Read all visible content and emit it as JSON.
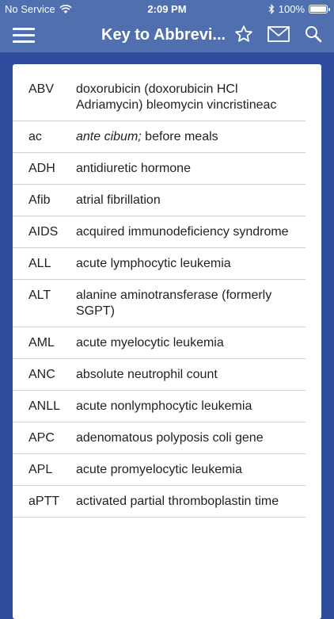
{
  "status": {
    "carrier": "No Service",
    "time": "2:09 PM",
    "battery": "100%",
    "battery_level": 1.0
  },
  "nav": {
    "title": "Key to Abbrevi..."
  },
  "rows": [
    {
      "abbr": "ABV",
      "def": "doxorubicin (doxorubicin HCl Adriamycin) bleomycin vincristineac"
    },
    {
      "abbr": "ac",
      "def_italic": "ante cibum;",
      "def": " before meals"
    },
    {
      "abbr": "ADH",
      "def": "antidiuretic hormone"
    },
    {
      "abbr": "Afib",
      "def": "atrial fibrillation"
    },
    {
      "abbr": "AIDS",
      "def": "acquired immunodeficiency syndrome"
    },
    {
      "abbr": "ALL",
      "def": "acute lymphocytic leukemia"
    },
    {
      "abbr": "ALT",
      "def": "alanine aminotransferase (formerly SGPT)"
    },
    {
      "abbr": "AML",
      "def": "acute myelocytic leukemia"
    },
    {
      "abbr": "ANC",
      "def": "absolute neutrophil count"
    },
    {
      "abbr": "ANLL",
      "def": "acute nonlymphocytic leukemia"
    },
    {
      "abbr": "APC",
      "def": "adenomatous polyposis coli gene"
    },
    {
      "abbr": "APL",
      "def": "acute promyelocytic leukemia"
    },
    {
      "abbr": "aPTT",
      "def": "activated partial thromboplastin time"
    }
  ]
}
